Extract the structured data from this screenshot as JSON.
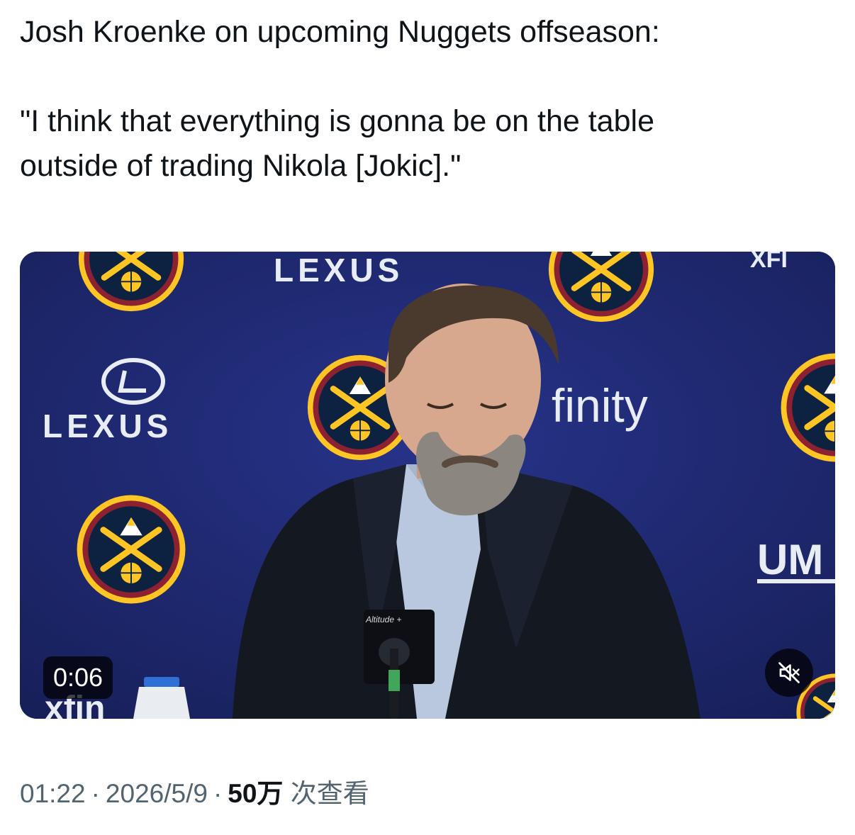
{
  "tweet": {
    "line1": "Josh Kroenke on upcoming Nuggets offseason:",
    "quote_line1": "\"I think that everything is gonna be on the table",
    "quote_line2": "outside of trading Nikola [Jokic].\""
  },
  "video": {
    "timestamp": "0:06",
    "backdrop_texts": {
      "lexus_top": "LEXUS",
      "lexus_left": "LEXUS",
      "xfinity_mid": "finity",
      "um_right": "UM",
      "xfinity_bottom": "xfin",
      "xfin_top_right": "XFI"
    },
    "mic_label": "Altitude +",
    "mute_icon": "muted-speaker-icon"
  },
  "meta": {
    "time": "01:22",
    "date": "2026/5/9",
    "views_count": "50万",
    "views_label": "次查看",
    "separator": "·"
  },
  "colors": {
    "backdrop_navy": "#1e2a6e",
    "nuggets_yellow": "#fec524",
    "nuggets_red": "#8b2131",
    "text_primary": "#0f1419",
    "text_secondary": "#536471"
  }
}
